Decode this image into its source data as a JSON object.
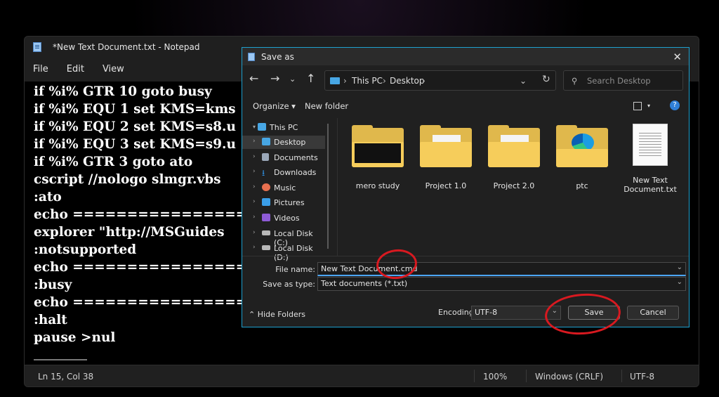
{
  "notepad": {
    "title": "*New Text Document.txt - Notepad",
    "menu": [
      "File",
      "Edit",
      "View"
    ],
    "lines": [
      "if %i% GTR 10 goto busy",
      "if %i% EQU 1 set KMS=kms",
      "if %i% EQU 2 set KMS=s8.u",
      "if %i% EQU 3 set KMS=s9.u",
      "if %i% GTR 3 goto ato",
      "cscript //nologo slmgr.vbs",
      ":ato",
      "echo ====================",
      "explorer \"http://MSGuides",
      ":notsupported",
      "echo ====================",
      ":busy",
      "echo ====================",
      ":halt",
      "pause >nul"
    ],
    "status": {
      "position": "Ln 15, Col 38",
      "zoom": "100%",
      "line_ending": "Windows (CRLF)",
      "encoding": "UTF-8"
    }
  },
  "dialog": {
    "title": "Save as",
    "close_glyph": "✕",
    "breadcrumb": [
      "This PC",
      "Desktop"
    ],
    "search_placeholder": "Search Desktop",
    "organize_label": "Organize ▾",
    "new_folder_label": "New folder",
    "nav_items": [
      {
        "label": "This PC",
        "icon": "pc-icon",
        "color": "#47a6e4"
      },
      {
        "label": "Desktop",
        "icon": "desktop-icon",
        "color": "#47a6e4"
      },
      {
        "label": "Documents",
        "icon": "documents-icon",
        "color": "#9aa7b8"
      },
      {
        "label": "Downloads",
        "icon": "download-icon",
        "color": "#2f8fe0"
      },
      {
        "label": "Music",
        "icon": "music-icon",
        "color": "#e8704f"
      },
      {
        "label": "Pictures",
        "icon": "pictures-icon",
        "color": "#3a9ee8"
      },
      {
        "label": "Videos",
        "icon": "videos-icon",
        "color": "#8e5bd6"
      },
      {
        "label": "Local Disk (C:)",
        "icon": "drive-icon",
        "color": "#b8b8b8"
      },
      {
        "label": "Local Disk (D:)",
        "icon": "drive-icon",
        "color": "#b8b8b8"
      }
    ],
    "files": [
      {
        "name": "mero study",
        "kind": "folder-thumb"
      },
      {
        "name": "Project 1.0",
        "kind": "folder-paper"
      },
      {
        "name": "Project 2.0",
        "kind": "folder-paper"
      },
      {
        "name": "ptc",
        "kind": "folder-edge"
      },
      {
        "name_line1": "New Text",
        "name_line2": "Document.txt",
        "kind": "text-file"
      }
    ],
    "file_name_label": "File name:",
    "file_name_value": "New Text Document.cmd",
    "save_as_type_label": "Save as type:",
    "save_as_type_value": "Text documents (*.txt)",
    "hide_folders_label": "Hide Folders",
    "encoding_label": "Encoding:",
    "encoding_value": "UTF-8",
    "save_label": "Save",
    "cancel_label": "Cancel"
  },
  "colors": {
    "accent": "#1ea0ce",
    "annotation": "#d81920",
    "folder": "#f6cd5b"
  }
}
